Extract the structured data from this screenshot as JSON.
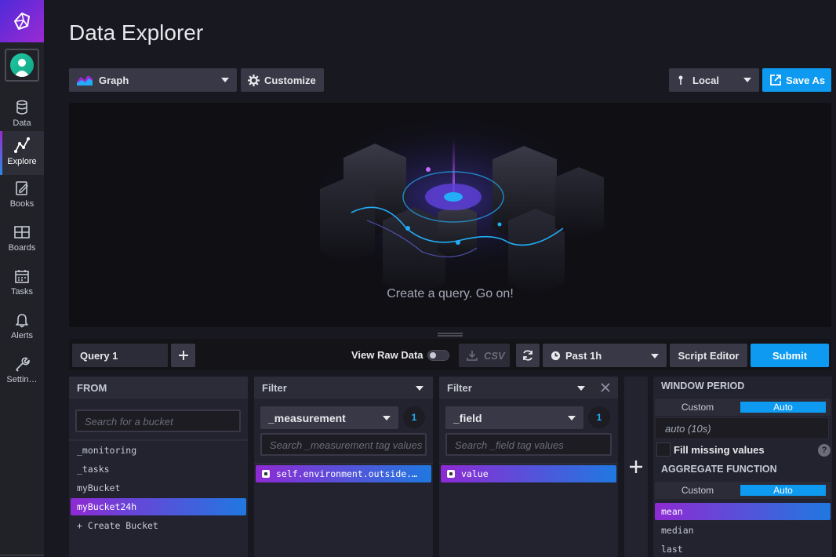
{
  "sidebar": {
    "items": [
      {
        "label": "Data",
        "icon": "database-icon"
      },
      {
        "label": "Explore",
        "icon": "graph-line-icon"
      },
      {
        "label": "Books",
        "icon": "notebook-icon"
      },
      {
        "label": "Boards",
        "icon": "dashboard-grid-icon"
      },
      {
        "label": "Tasks",
        "icon": "calendar-icon"
      },
      {
        "label": "Alerts",
        "icon": "bell-icon"
      },
      {
        "label": "Settin…",
        "icon": "wrench-icon"
      }
    ],
    "active": "Explore"
  },
  "header": {
    "title": "Data Explorer",
    "vis_type": "Graph",
    "customize_label": "Customize",
    "timezone": "Local",
    "save_as_label": "Save As"
  },
  "graph": {
    "empty_message": "Create a query. Go on!"
  },
  "query_bar": {
    "query_tab": "Query 1",
    "add_query_icon": "plus-icon",
    "view_raw_label": "View Raw Data",
    "csv_label": "CSV",
    "time_range": "Past 1h",
    "script_editor_label": "Script Editor",
    "submit_label": "Submit"
  },
  "from_panel": {
    "title": "FROM",
    "search_placeholder": "Search for a bucket",
    "buckets": [
      "_monitoring",
      "_tasks",
      "myBucket",
      "myBucket24h"
    ],
    "selected": "myBucket24h",
    "create_label": "+ Create Bucket"
  },
  "filter1": {
    "title": "Filter",
    "key": "_measurement",
    "count": "1",
    "search_placeholder": "Search _measurement tag values",
    "values": [
      "self.environment.outside.temperature"
    ]
  },
  "filter2": {
    "title": "Filter",
    "key": "_field",
    "count": "1",
    "search_placeholder": "Search _field tag values",
    "values": [
      "value"
    ]
  },
  "right_panel": {
    "window_period_title": "WINDOW PERIOD",
    "custom_label": "Custom",
    "auto_label": "Auto",
    "window_value": "auto (10s)",
    "fill_missing_label": "Fill missing values",
    "aggregate_title": "AGGREGATE FUNCTION",
    "functions": [
      "mean",
      "median",
      "last"
    ],
    "selected_function": "mean"
  },
  "colors": {
    "accent": "#0d9af0",
    "purple": "#9b2ad3",
    "background": "#181820"
  }
}
